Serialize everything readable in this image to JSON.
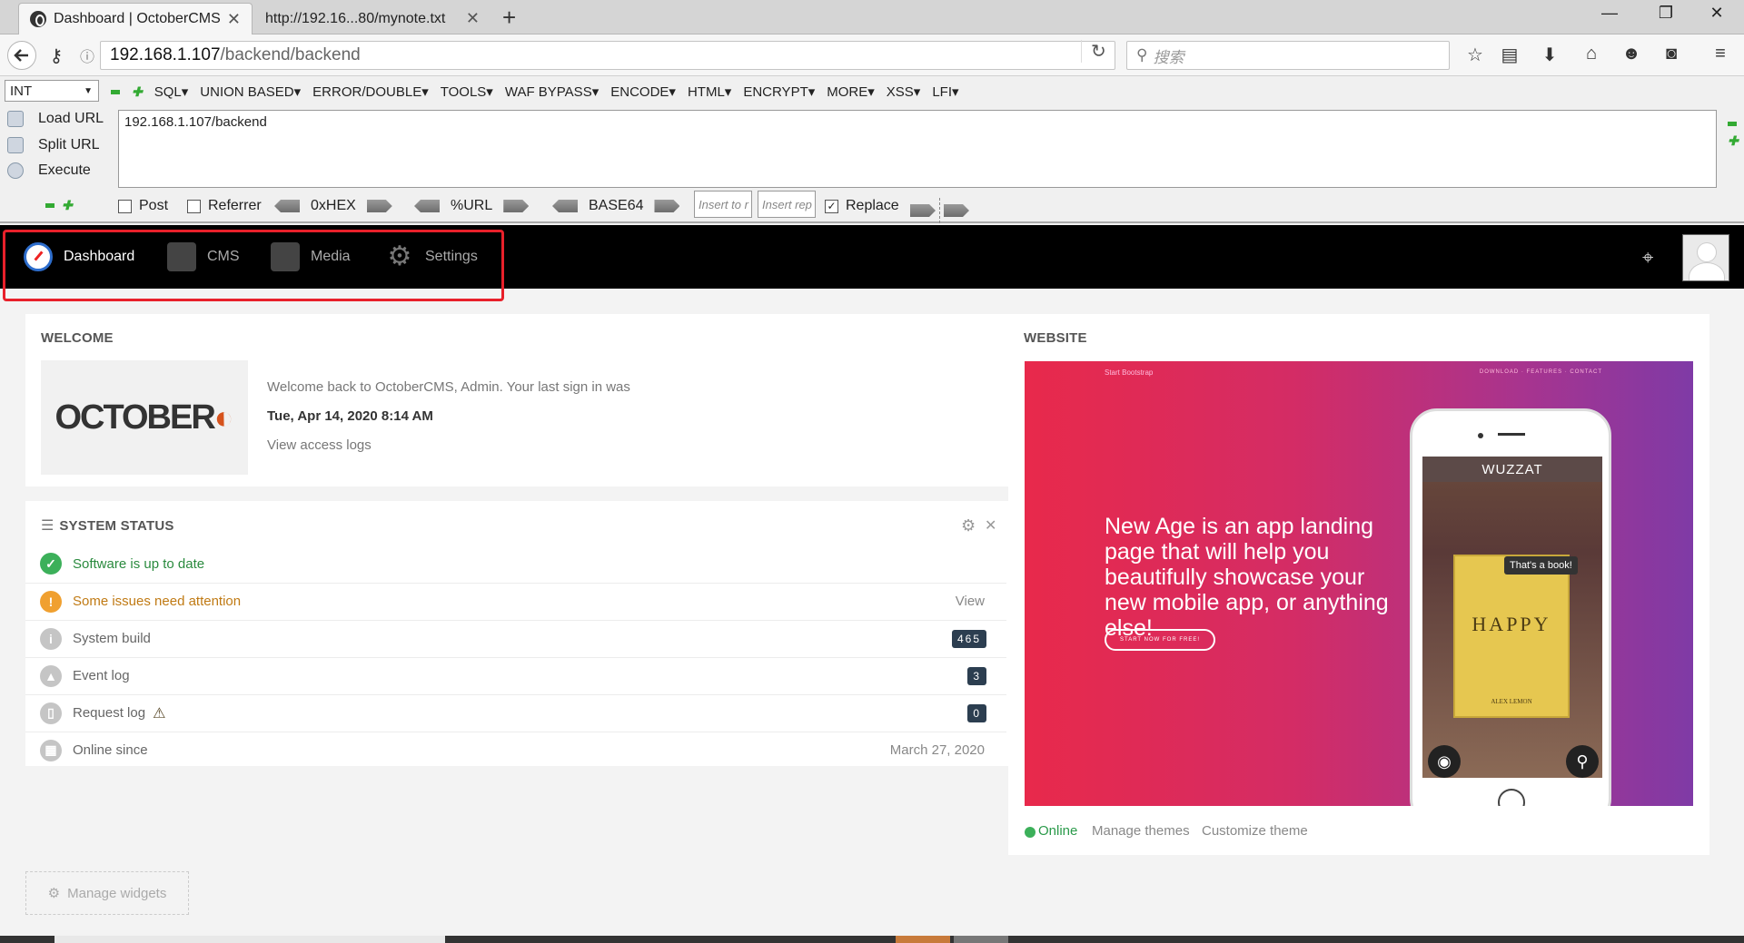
{
  "browser": {
    "tabs": [
      {
        "title": "Dashboard | OctoberCMS",
        "active": true
      },
      {
        "title": "http://192.16...80/mynote.txt",
        "active": false
      }
    ],
    "new_tab": "+",
    "window_controls": {
      "minimize": "—",
      "restore": "❐",
      "close": "✕"
    },
    "url_host": "192.168.1.107",
    "url_path": "/backend/backend",
    "search_placeholder": "搜索"
  },
  "hackbar": {
    "select_value": "INT",
    "menus": [
      "SQL",
      "UNION BASED",
      "ERROR/DOUBLE",
      "TOOLS",
      "WAF BYPASS",
      "ENCODE",
      "HTML",
      "ENCRYPT",
      "MORE",
      "XSS",
      "LFI"
    ],
    "actions": {
      "load": "Load URL",
      "split": "Split URL",
      "execute": "Execute"
    },
    "url_text": "192.168.1.107/backend",
    "post_label": "Post",
    "referrer_label": "Referrer",
    "hex_label": "0xHEX",
    "url_label": "%URL",
    "base64_label": "BASE64",
    "insert_to_placeholder": "Insert to r",
    "insert_rep_placeholder": "Insert rep",
    "replace_label": "Replace"
  },
  "october_nav": {
    "items": [
      {
        "label": "Dashboard",
        "active": true
      },
      {
        "label": "CMS"
      },
      {
        "label": "Media"
      },
      {
        "label": "Settings"
      }
    ]
  },
  "welcome": {
    "title": "WELCOME",
    "logo": "OCTOBER",
    "line1": "Welcome back to OctoberCMS, Admin. Your last sign in was",
    "date": "Tue, Apr 14, 2020 8:14 AM",
    "access_logs": "View access logs"
  },
  "system_status": {
    "title": "SYSTEM STATUS",
    "rows": [
      {
        "label": "Software is up to date",
        "status": "ok"
      },
      {
        "label": "Some issues need attention",
        "status": "warning",
        "right": "View"
      },
      {
        "label": "System build",
        "badge": "465"
      },
      {
        "label": "Event log",
        "badge": "3"
      },
      {
        "label": "Request log",
        "badge": "0"
      },
      {
        "label": "Online since",
        "right": "March 27, 2020"
      }
    ]
  },
  "website": {
    "title": "WEBSITE",
    "preview": {
      "brand": "Start Bootstrap",
      "nav": "DOWNLOAD · FEATURES · CONTACT",
      "headline": "New Age is an app landing page that will help you beautifully showcase your new mobile app, or anything else!",
      "cta": "START NOW FOR FREE!",
      "app_name": "WUZZAT",
      "bubble": "That's a book!",
      "book_title": "HAPPY",
      "book_author": "ALEX LEMON"
    },
    "online": "Online",
    "manage_themes": "Manage themes",
    "customize_theme": "Customize theme"
  },
  "manage_widgets": "Manage widgets",
  "colors": {
    "accent_red": "#e8202a",
    "status_ok": "#3cb05a",
    "status_warning": "#f0a030",
    "badge": "#2c3e50"
  }
}
